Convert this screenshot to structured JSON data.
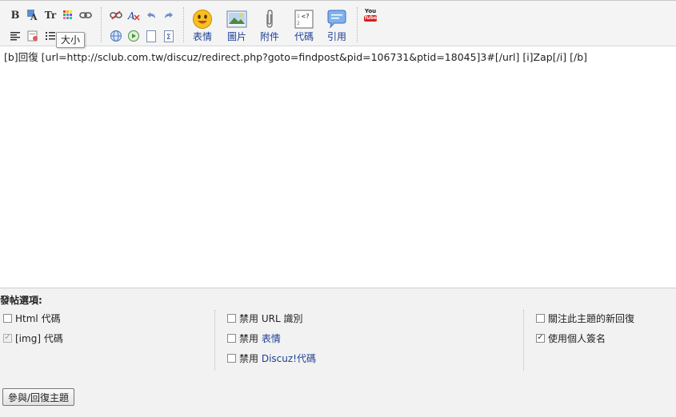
{
  "toolbar": {
    "tooltip": "大小",
    "bold_label": "B",
    "fontsize_label": "Tr",
    "buttons": [
      {
        "label": "表情",
        "icon": "smiley-icon"
      },
      {
        "label": "圖片",
        "icon": "image-icon"
      },
      {
        "label": "附件",
        "icon": "paperclip-icon"
      },
      {
        "label": "代碼",
        "icon": "code-icon"
      },
      {
        "label": "引用",
        "icon": "quote-icon"
      }
    ],
    "youtube_label_top": "You",
    "youtube_label_bottom": "Tube",
    "code_icon_text": "<?"
  },
  "editor": {
    "content": "[b]回復 [url=http://sclub.com.tw/discuz/redirect.php?goto=findpost&pid=106731&ptid=18045]3#[/url] [i]Zap[/i] [/b]"
  },
  "options": {
    "title": "發帖選項:",
    "col1": [
      {
        "label": "Html 代碼",
        "checked": false,
        "disabled": false
      },
      {
        "label": "[img] 代碼",
        "checked": true,
        "disabled": true
      }
    ],
    "col2": [
      {
        "prefix": "禁用",
        "label": "URL 識別",
        "checked": false
      },
      {
        "prefix": "禁用",
        "label": "表情",
        "checked": false
      },
      {
        "prefix": "禁用",
        "label": "Discuz!代碼",
        "checked": false
      }
    ],
    "col3": [
      {
        "label": "關注此主題的新回復",
        "checked": false
      },
      {
        "label": "使用個人簽名",
        "checked": true
      }
    ]
  },
  "submit_label": "參與/回復主題"
}
